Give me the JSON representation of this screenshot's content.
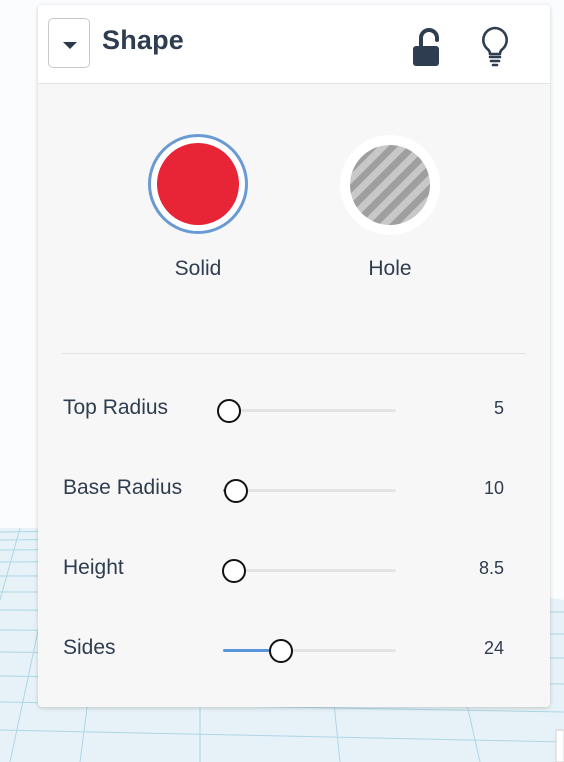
{
  "panel": {
    "title": "Shape"
  },
  "header_icons": [
    "chevron-down-icon",
    "unlock-icon",
    "lightbulb-icon"
  ],
  "colors": {
    "solid": "#e82437",
    "selected_outline": "#6a9ad4",
    "text": "#2e3d4f",
    "slider_fill": "#5b95d9"
  },
  "types": {
    "solid_label": "Solid",
    "hole_label": "Hole",
    "selected": "Solid"
  },
  "params": [
    {
      "label": "Top Radius",
      "value": "5",
      "slider_fraction": 0.03
    },
    {
      "label": "Base Radius",
      "value": "10",
      "slider_fraction": 0.07
    },
    {
      "label": "Height",
      "value": "8.5",
      "slider_fraction": 0.06
    },
    {
      "label": "Sides",
      "value": "24",
      "slider_fraction": 0.33
    }
  ]
}
